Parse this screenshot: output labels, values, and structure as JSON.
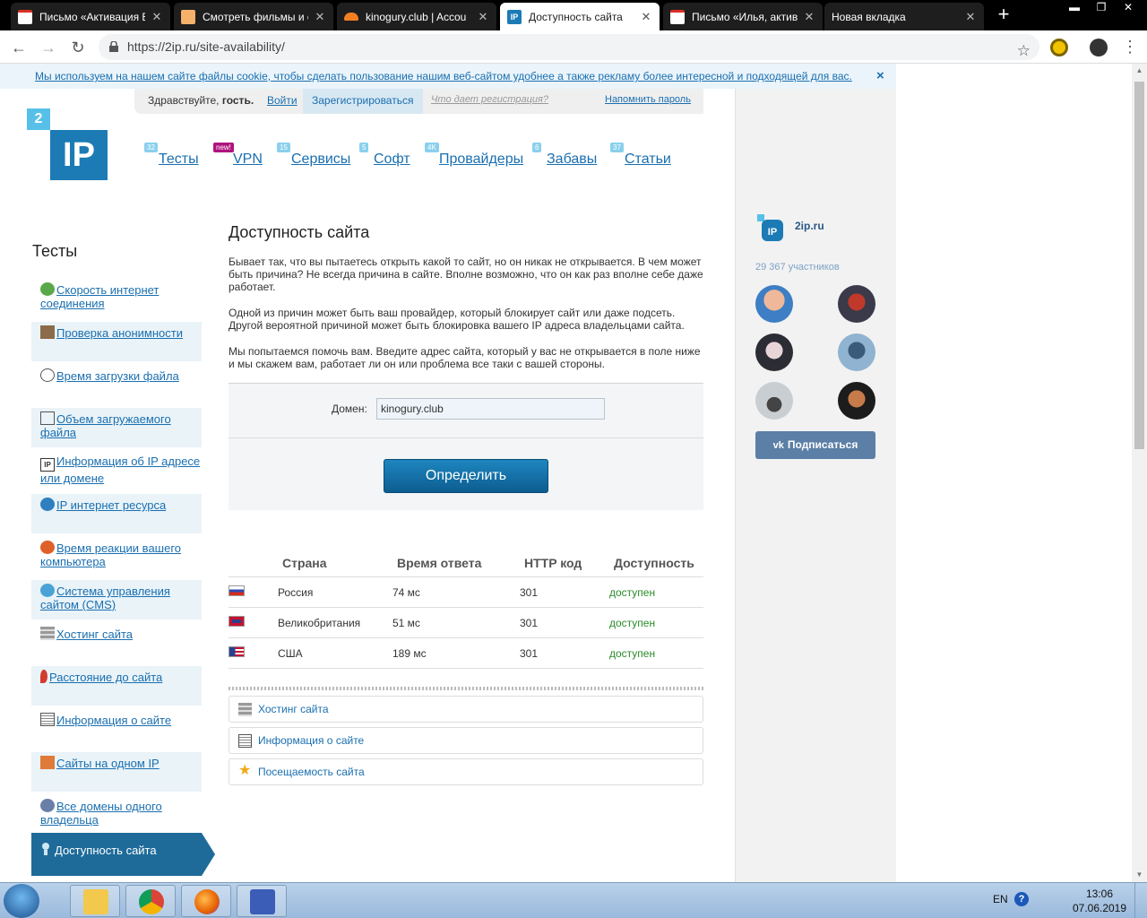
{
  "browser": {
    "tabs": [
      {
        "label": "Письмо «Активация E",
        "icon": "gmail-icon",
        "active": false
      },
      {
        "label": "Смотреть фильмы и с",
        "icon": "film-site-icon",
        "active": false
      },
      {
        "label": "kinogury.club | Accou",
        "icon": "cloudflare-icon",
        "active": false
      },
      {
        "label": "Доступность сайта",
        "icon": "2ip-icon",
        "active": true
      },
      {
        "label": "Письмо «Илья, актив",
        "icon": "gmail-icon",
        "active": false
      },
      {
        "label": "Новая вкладка",
        "icon": "blank-icon",
        "active": false
      }
    ],
    "url": "https://2ip.ru/site-availability/"
  },
  "cookie_notice": {
    "text": "Мы используем на нашем сайте файлы cookie, чтобы сделать пользование нашим веб-сайтом удобнее а также рекламу более интересной и подходящей для вас.",
    "close": "×"
  },
  "login_bar": {
    "greeting": "Здравствуйте,",
    "guest": "гость.",
    "login": "Войти",
    "register": "Зарегистрироваться",
    "why_register": "Что дает регистрация?",
    "remind": "Напомнить пароль"
  },
  "logo": {
    "small": "2",
    "big": "IP"
  },
  "top_nav": [
    {
      "label": "Тесты",
      "badge": "32"
    },
    {
      "label": "VPN",
      "badge": "new!"
    },
    {
      "label": "Сервисы",
      "badge": "15"
    },
    {
      "label": "Софт",
      "badge": "5"
    },
    {
      "label": "Провайдеры",
      "badge": "4K"
    },
    {
      "label": "Забавы",
      "badge": "6"
    },
    {
      "label": "Статьи",
      "badge": "37"
    }
  ],
  "sidebar": {
    "title": "Тесты",
    "items": [
      {
        "label": "Скорость интернет соединения",
        "icon": "speed-arrow-icon"
      },
      {
        "label": "Проверка анонимности",
        "icon": "spy-icon"
      },
      {
        "label": "Время загрузки файла",
        "icon": "clock-icon"
      },
      {
        "label": "Объем загружаемого файла",
        "icon": "file-size-icon"
      },
      {
        "label": "Информация об IP адресе или домене",
        "icon": "ip-icon"
      },
      {
        "label": "IP интернет ресурса",
        "icon": "ip-globe-icon"
      },
      {
        "label": "Время реакции вашего компьютера",
        "icon": "reaction-icon"
      },
      {
        "label": "Система управления сайтом (CMS)",
        "icon": "cms-icon"
      },
      {
        "label": "Хостинг сайта",
        "icon": "hosting-icon"
      },
      {
        "label": "Расстояние до сайта",
        "icon": "map-pin-icon"
      },
      {
        "label": "Информация о сайте",
        "icon": "site-info-icon"
      },
      {
        "label": "Сайты на одном IP",
        "icon": "sites-ip-icon"
      },
      {
        "label": "Все домены одного владельца",
        "icon": "owner-domains-icon"
      }
    ],
    "active": "Доступность сайта"
  },
  "main": {
    "title": "Доступность сайта",
    "p1": "Бывает так, что вы пытаетесь открыть какой то сайт, но он никак не открывается. В чем может быть причина? Не всегда причина в сайте. Вполне возможно, что он как раз вполне себе даже работает.",
    "p2": "Одной из причин может быть ваш провайдер, который блокирует сайт или даже подсеть. Другой вероятной причиной может быть блокировка вашего IP адреса владельцами сайта.",
    "p3": "Мы попытаемся помочь вам. Введите адрес сайта, который у вас не открывается в поле ниже и мы скажем вам, работает ли он или проблема все таки с вашей стороны.",
    "domain_label": "Домен:",
    "domain_value": "kinogury.club",
    "submit": "Определить"
  },
  "results": {
    "headers": [
      "Страна",
      "Время ответа",
      "HTTP код",
      "Доступность"
    ],
    "rows": [
      {
        "country": "Россия",
        "time": "74 мс",
        "code": "301",
        "status": "доступен",
        "flag": "ru-flag-icon"
      },
      {
        "country": "Великобритания",
        "time": "51 мс",
        "code": "301",
        "status": "доступен",
        "flag": "uk-flag-icon"
      },
      {
        "country": "США",
        "time": "189 мс",
        "code": "301",
        "status": "доступен",
        "flag": "us-flag-icon"
      }
    ]
  },
  "tools": [
    {
      "label": "Хостинг сайта",
      "icon": "hosting-icon"
    },
    {
      "label": "Информация о сайте",
      "icon": "site-info-icon"
    },
    {
      "label": "Посещаемость сайта",
      "icon": "star-icon"
    }
  ],
  "vk_widget": {
    "name": "2ip.ru",
    "members": "29 367 участников",
    "subscribe": "Подписаться"
  },
  "taskbar": {
    "lang": "EN",
    "time": "13:06",
    "date": "07.06.2019"
  },
  "colors": {
    "link": "#1a6fb0",
    "accent": "#1e6b9a",
    "ok": "#2a8b2a"
  }
}
